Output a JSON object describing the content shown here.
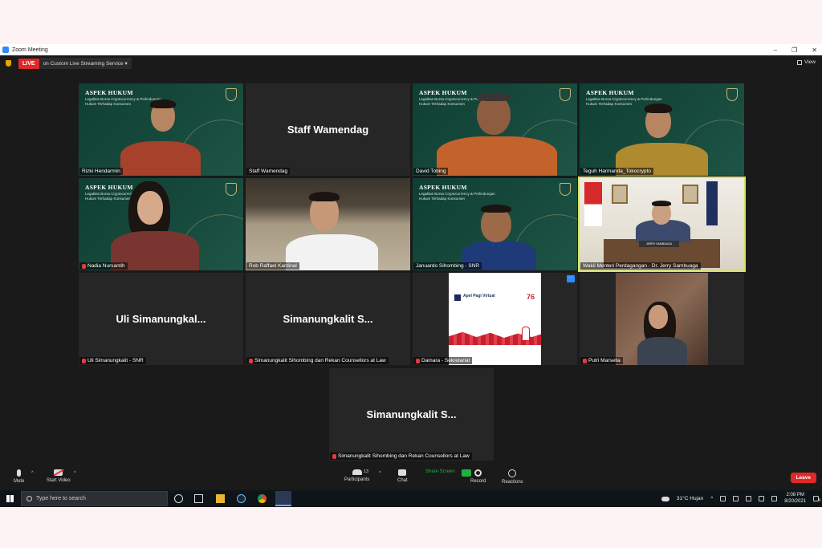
{
  "window": {
    "title": "Zoom Meeting",
    "min": "–",
    "max": "❐",
    "close": "✕"
  },
  "livebar": {
    "live_label": "LIVE",
    "service": "on Custom Live Streaming Service",
    "service_caret": "▾",
    "view_label": "View"
  },
  "backgrounds": {
    "header": "ASPEK HUKUM",
    "subtitle": "Legalitas Bursa Cryptocurrency & Perlindungan Hukum Terhadap Konsumen"
  },
  "tiles": [
    {
      "name": "Rizki Hendarmin",
      "muted": false
    },
    {
      "name": "Staff Wamendag",
      "display": "Staff Wamendag",
      "muted": false
    },
    {
      "name": "David Tobing",
      "muted": false
    },
    {
      "name": "Teguh Harmanda_Tokocrypto",
      "muted": false
    },
    {
      "name": "Nadia Nursantih",
      "muted": true
    },
    {
      "name": "Rob Raffael Kardinal",
      "muted": false
    },
    {
      "name": "Januardo Sihombing - SNR",
      "muted": false
    },
    {
      "name": "Wakil Menteri Perdagangan - Dr. Jerry Sambuaga",
      "muted": false
    },
    {
      "name": "Uli Simanungkalit - SNR",
      "display": "Uli Simanungkal...",
      "muted": true
    },
    {
      "name": "Simanungkalit Sihombing dan Rekan Counsellors at Law",
      "display": "Simanungkalit S...",
      "muted": true
    },
    {
      "name": "Damara - Sekretariat",
      "muted": true
    },
    {
      "name": "Putri Marsella",
      "muted": true
    },
    {
      "name": "Simanungkalit Sihombing dan Rekan Counsellors at Law",
      "display": "Simanungkalit S...",
      "muted": true
    }
  ],
  "shared_screen": {
    "title": "Apel Pagi Virtual",
    "number": "76",
    "more": "···"
  },
  "nameplate_tag": "JERRY SAMBUAGA",
  "toolbar": {
    "mute": "Mute",
    "start_video": "Start Video",
    "participants": "Participants",
    "participants_count": "13",
    "chat": "Chat",
    "share_screen": "Share Screen",
    "record": "Record",
    "reactions": "Reactions",
    "leave": "Leave",
    "caret": "^"
  },
  "taskbar": {
    "search_placeholder": "Type here to search",
    "weather": "31°C  Hujan",
    "time": "2:08 PM",
    "date": "8/20/2021",
    "notif_count": "4"
  },
  "colors": {
    "live": "#e02828",
    "speaking": "#d8e35a",
    "share_green": "#1fb141",
    "zoom_blue": "#2d8cff"
  }
}
